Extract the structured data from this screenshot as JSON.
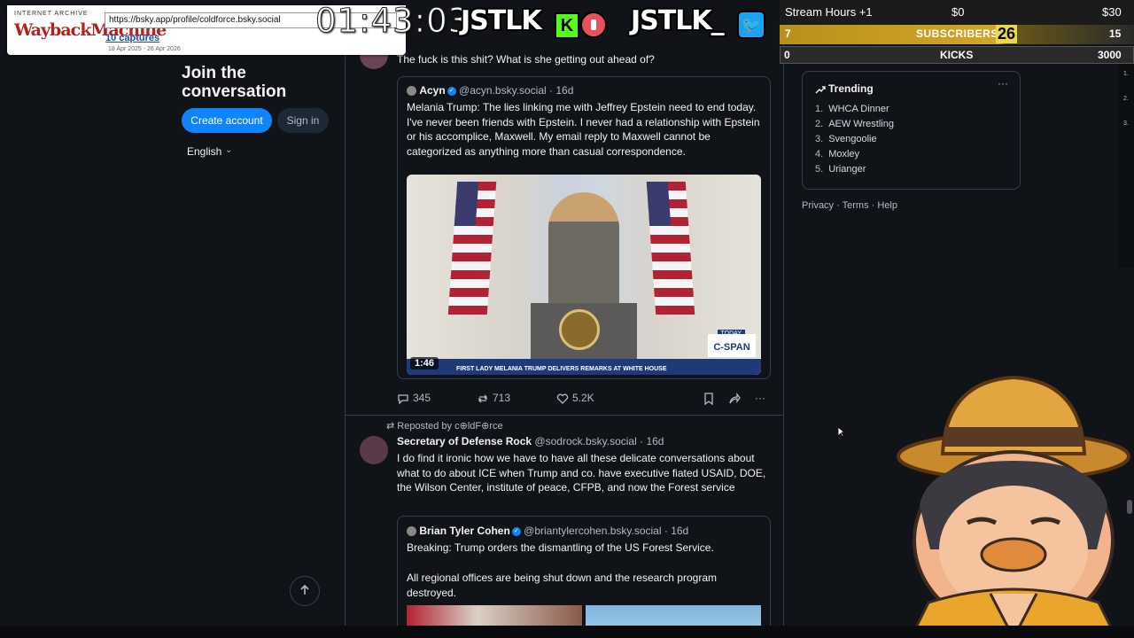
{
  "wayback": {
    "logo_top": "INTERNET ARCHIVE",
    "logo_main": "WaybackMachine",
    "url": "https://bsky.app/profile/coldforce.bsky.social",
    "captures": "10 captures",
    "date_range": "18 Apr 2025 - 26 Apr 2026"
  },
  "overlay": {
    "timer": "01:43:03",
    "brand_left": "JSTLK",
    "brand_right": "JSTLK_",
    "kick_letter": "K"
  },
  "goals": {
    "title": "Stream Hours +1",
    "min_label": "$0",
    "max_label": "$30",
    "subs_count": "7",
    "subs_label": "SUBSCRIBERS",
    "subs_marker": "26",
    "subs_goal": "15",
    "kicks_count": "0",
    "kicks_label": "KICKS",
    "kicks_goal": "3000"
  },
  "left": {
    "join_title": "Join the conversation",
    "create_account": "Create account",
    "sign_in": "Sign in",
    "language": "English"
  },
  "feed": {
    "top_text": "The fuck is this shit? What is she getting out ahead of?",
    "quote1": {
      "author": "Acyn",
      "handle": "@acyn.bsky.social",
      "age": "· 16d",
      "text": "Melania Trump: The lies linking me with Jeffrey Epstein need to end today. I've never been friends with Epstein. I never had a relationship with Epstein or his accomplice, Maxwell. My email reply to Maxwell cannot be categorized as anything more than casual correspondence.",
      "video_duration": "1:46",
      "chyron": "FIRST LADY MELANIA TRUMP DELIVERS REMARKS AT WHITE HOUSE",
      "today": "TODAY",
      "network": "C-SPAN"
    },
    "actions1": {
      "replies": "345",
      "reposts": "713",
      "likes": "5.2K"
    },
    "post2": {
      "repost_label": "Reposted by c⊕ldF⊕rce",
      "author": "Secretary of Defense Rock",
      "handle": "@sodrock.bsky.social",
      "age": "· 16d",
      "text": "I do find it ironic how we have to have all these delicate conversations about what to do about ICE when Trump and co. have executive fiated USAID, DOE, the Wilson Center, institute of peace, CFPB, and now the Forest service",
      "quote": {
        "author": "Brian Tyler Cohen",
        "handle": "@briantylercohen.bsky.social",
        "age": "· 16d",
        "text1": "Breaking: Trump orders the dismantling of the US Forest Service.",
        "text2": "All regional offices are being shut down and the research program destroyed."
      }
    }
  },
  "trending": {
    "title": "Trending",
    "items": [
      {
        "num": "1.",
        "label": "WHCA Dinner"
      },
      {
        "num": "2.",
        "label": "AEW Wrestling"
      },
      {
        "num": "3.",
        "label": "Svengoolie"
      },
      {
        "num": "4.",
        "label": "Moxley"
      },
      {
        "num": "5.",
        "label": "Urianger"
      }
    ]
  },
  "footer": {
    "privacy": "Privacy",
    "terms": "Terms",
    "help": "Help"
  },
  "scroll_strip": [
    "1.",
    "2.",
    "3."
  ]
}
